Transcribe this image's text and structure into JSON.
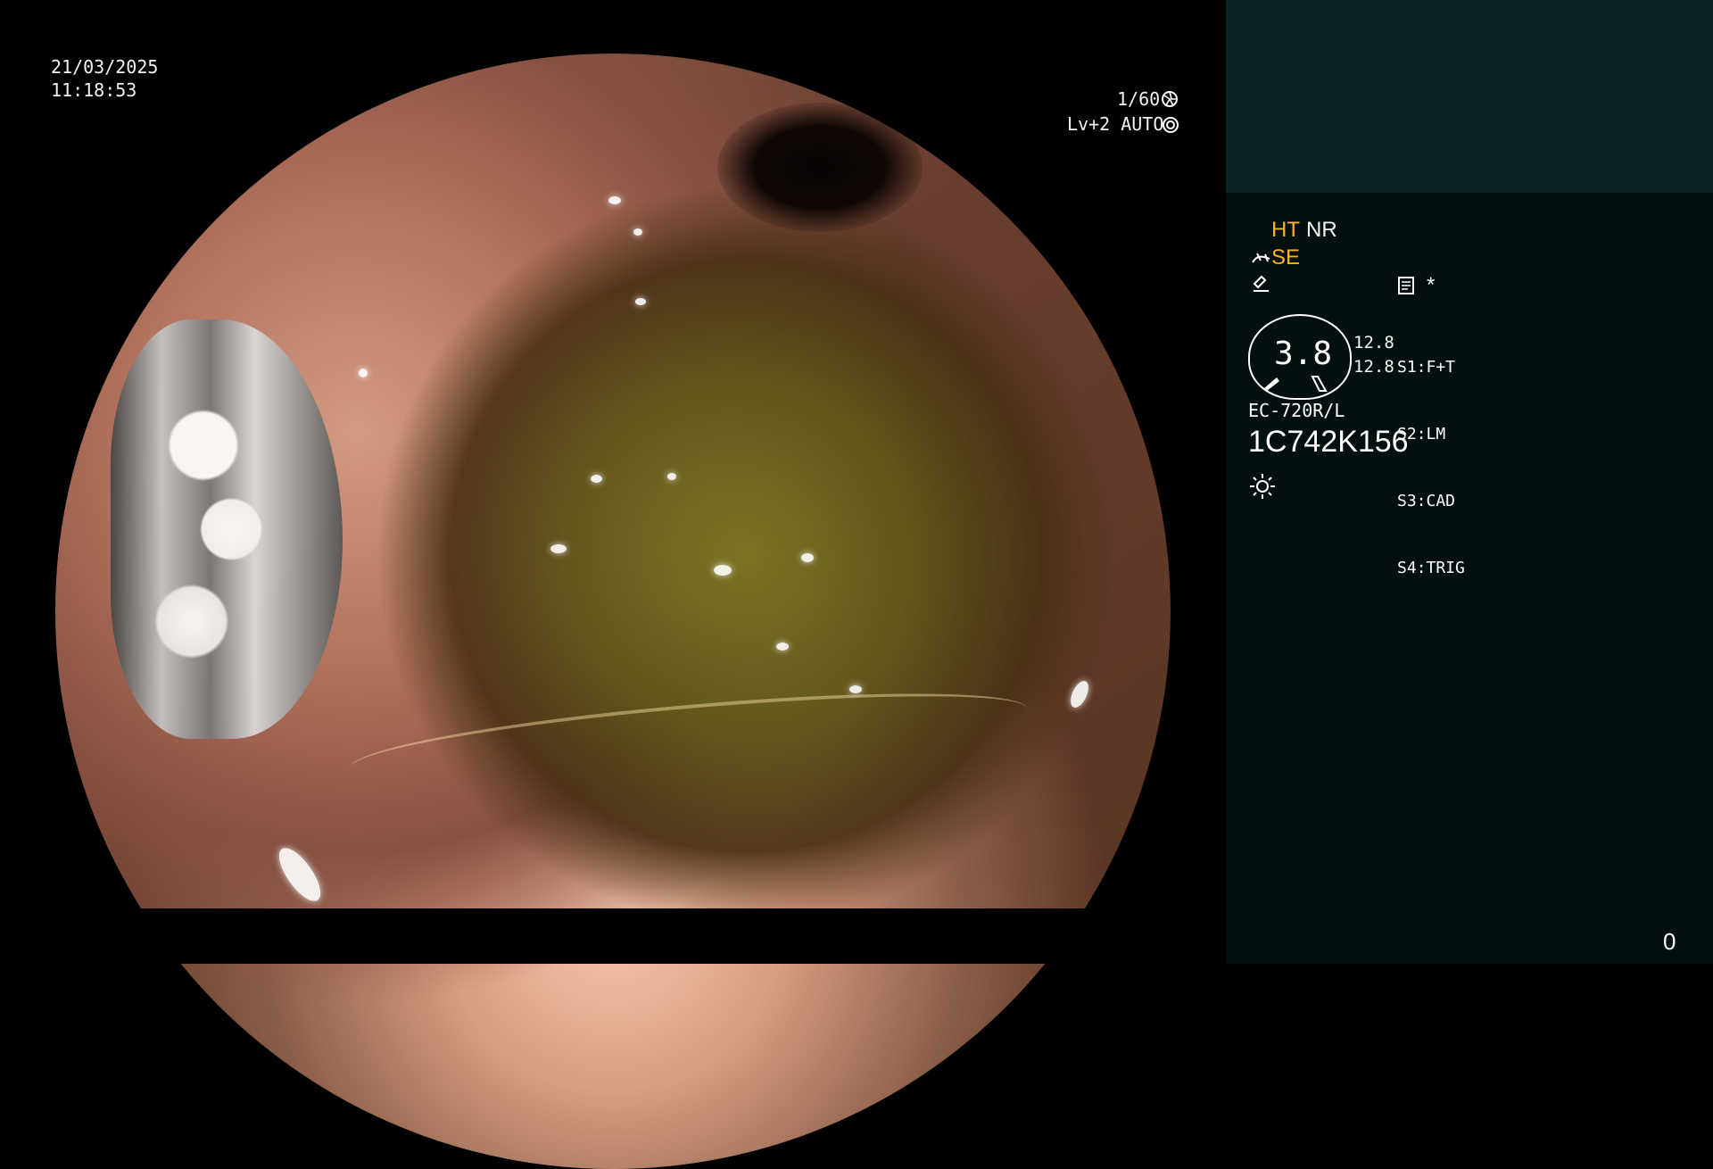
{
  "overlay": {
    "date": "21/03/2025",
    "time": "11:18:53",
    "shutter": "1/60",
    "level_mode": "Lv+2 AUTO"
  },
  "panel": {
    "ht": "HT",
    "nr": "NR",
    "se": "SE",
    "gauge_value": "3.8",
    "left_value_1": "12.8",
    "left_value_2": "12.8",
    "settings": [
      "S1:F+T",
      "S2:LM",
      "S3:CAD",
      "S4:TRIG"
    ],
    "model": "EC-720R/L",
    "serial": "1C742K156",
    "counter": "0"
  },
  "icons": {
    "shutter_icon": "aperture-icon",
    "auto_icon": "auto-exposure-icon",
    "scope_icon": "scope-icon",
    "freeze_icon": "freeze-icon",
    "document_icon": "document-icon",
    "star_icon": "star-icon",
    "light_icon": "light-icon"
  },
  "colors": {
    "accent_yellow": "#ffb21f",
    "panel_bg": "#04100f",
    "panel_teal": "#0d2426"
  }
}
